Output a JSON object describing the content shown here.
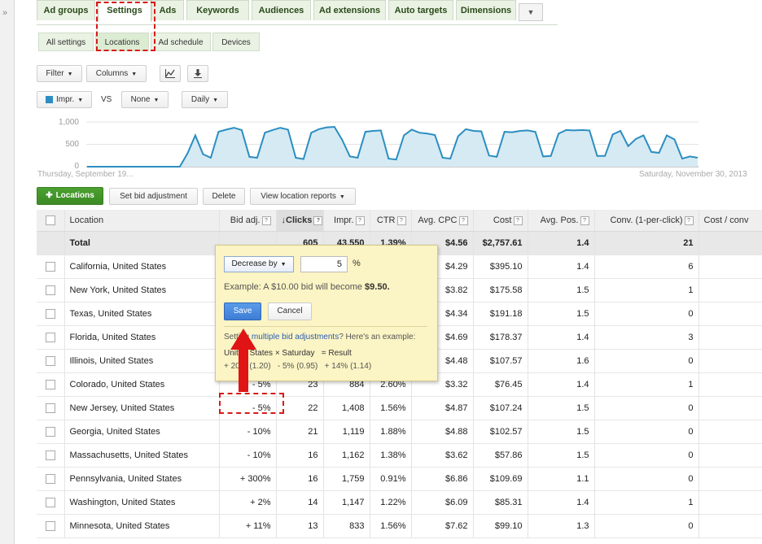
{
  "left_rail": {
    "icon": "double-chevron-right"
  },
  "tabs": [
    "Ad groups",
    "Settings",
    "Ads",
    "Keywords",
    "Audiences",
    "Ad extensions",
    "Auto targets",
    "Dimensions"
  ],
  "tabs_more_icon": "caret-down",
  "subtabs": [
    "All settings",
    "Locations",
    "Ad schedule",
    "Devices"
  ],
  "toolbar": {
    "filter": "Filter",
    "columns": "Columns"
  },
  "metric_row": {
    "metric1": "Impr.",
    "vs": "VS",
    "metric2": "None",
    "period": "Daily"
  },
  "chart_data": {
    "type": "area",
    "series": [
      {
        "name": "Impr.",
        "values": [
          0,
          0,
          0,
          0,
          0,
          0,
          0,
          0,
          0,
          0,
          0,
          0,
          0,
          300,
          700,
          280,
          200,
          780,
          830,
          870,
          820,
          220,
          200,
          760,
          820,
          870,
          830,
          200,
          170,
          760,
          840,
          880,
          890,
          600,
          230,
          200,
          780,
          800,
          810,
          180,
          160,
          700,
          830,
          760,
          740,
          710,
          200,
          180,
          680,
          840,
          800,
          790,
          250,
          220,
          780,
          770,
          800,
          810,
          780,
          230,
          240,
          740,
          820,
          810,
          820,
          810,
          240,
          240,
          720,
          800,
          460,
          620,
          700,
          330,
          310,
          700,
          610,
          180,
          230,
          200
        ],
        "color": "#2b8ec1"
      }
    ],
    "yticks": [
      "1,000",
      "500",
      "0"
    ],
    "ylim": [
      0,
      1000
    ],
    "x_start_label": "Thursday, September 19...",
    "x_end_label": "Saturday, November 30, 2013",
    "grid": true
  },
  "actions": {
    "add_locations": "Locations",
    "set_bid": "Set bid adjustment",
    "delete": "Delete",
    "view_reports": "View location reports"
  },
  "table": {
    "headers": {
      "location": "Location",
      "bid_adj": "Bid adj.",
      "clicks": "Clicks",
      "impr": "Impr.",
      "ctr": "CTR",
      "avg_cpc": "Avg. CPC",
      "cost": "Cost",
      "avg_pos": "Avg. Pos.",
      "conv": "Conv. (1-per-click)",
      "cost_conv": "Cost / conv"
    },
    "total": {
      "label": "Total",
      "clicks": "605",
      "impr": "43,550",
      "ctr": "1.39%",
      "avg_cpc": "$4.56",
      "cost": "$2,757.61",
      "avg_pos": "1.4",
      "conv": "21"
    },
    "rows": [
      {
        "location": "California, United States",
        "bid_adj": "",
        "clicks": "",
        "impr": "",
        "ctr": "",
        "avg_cpc": "$4.29",
        "cost": "$395.10",
        "avg_pos": "1.4",
        "conv": "6"
      },
      {
        "location": "New York, United States",
        "bid_adj": "",
        "clicks": "",
        "impr": "",
        "ctr": "",
        "avg_cpc": "$3.82",
        "cost": "$175.58",
        "avg_pos": "1.5",
        "conv": "1"
      },
      {
        "location": "Texas, United States",
        "bid_adj": "",
        "clicks": "",
        "impr": "",
        "ctr": "",
        "avg_cpc": "$4.34",
        "cost": "$191.18",
        "avg_pos": "1.5",
        "conv": "0"
      },
      {
        "location": "Florida, United States",
        "bid_adj": "",
        "clicks": "",
        "impr": "",
        "ctr": "",
        "avg_cpc": "$4.69",
        "cost": "$178.37",
        "avg_pos": "1.4",
        "conv": "3"
      },
      {
        "location": "Illinois, United States",
        "bid_adj": "",
        "clicks": "",
        "impr": "",
        "ctr": "",
        "avg_cpc": "$4.48",
        "cost": "$107.57",
        "avg_pos": "1.6",
        "conv": "0"
      },
      {
        "location": "Colorado, United States",
        "bid_adj": "- 5%",
        "clicks": "23",
        "impr": "884",
        "ctr": "2.60%",
        "avg_cpc": "$3.32",
        "cost": "$76.45",
        "avg_pos": "1.4",
        "conv": "1"
      },
      {
        "location": "New Jersey, United States",
        "bid_adj": "- 5%",
        "clicks": "22",
        "impr": "1,408",
        "ctr": "1.56%",
        "avg_cpc": "$4.87",
        "cost": "$107.24",
        "avg_pos": "1.5",
        "conv": "0"
      },
      {
        "location": "Georgia, United States",
        "bid_adj": "- 10%",
        "clicks": "21",
        "impr": "1,119",
        "ctr": "1.88%",
        "avg_cpc": "$4.88",
        "cost": "$102.57",
        "avg_pos": "1.5",
        "conv": "0"
      },
      {
        "location": "Massachusetts, United States",
        "bid_adj": "- 10%",
        "clicks": "16",
        "impr": "1,162",
        "ctr": "1.38%",
        "avg_cpc": "$3.62",
        "cost": "$57.86",
        "avg_pos": "1.5",
        "conv": "0"
      },
      {
        "location": "Pennsylvania, United States",
        "bid_adj": "+ 300%",
        "clicks": "16",
        "impr": "1,759",
        "ctr": "0.91%",
        "avg_cpc": "$6.86",
        "cost": "$109.69",
        "avg_pos": "1.1",
        "conv": "0"
      },
      {
        "location": "Washington, United States",
        "bid_adj": "+ 2%",
        "clicks": "14",
        "impr": "1,147",
        "ctr": "1.22%",
        "avg_cpc": "$6.09",
        "cost": "$85.31",
        "avg_pos": "1.4",
        "conv": "1"
      },
      {
        "location": "Minnesota, United States",
        "bid_adj": "+ 11%",
        "clicks": "13",
        "impr": "833",
        "ctr": "1.56%",
        "avg_cpc": "$7.62",
        "cost": "$99.10",
        "avg_pos": "1.3",
        "conv": "0"
      }
    ]
  },
  "popup": {
    "mode": "Decrease by",
    "value": "5",
    "pct": "%",
    "example_prefix": "Example: A $10.00 bid will become ",
    "example_value": "$9.50.",
    "save": "Save",
    "cancel": "Cancel",
    "hint_prefix": "Setting ",
    "hint_link": "multiple bid adjustments",
    "hint_suffix": "? Here's an example:",
    "ex_row1": "United States × Saturday   = Result",
    "ex_row2": "+ 20% (1.20)   - 5% (0.95)   + 14% (1.14)"
  },
  "colors": {
    "accent_green": "#3c8a25",
    "annotation_red": "#e01414",
    "chart_blue": "#2b8ec1",
    "popup_bg": "#fbf4c4"
  }
}
